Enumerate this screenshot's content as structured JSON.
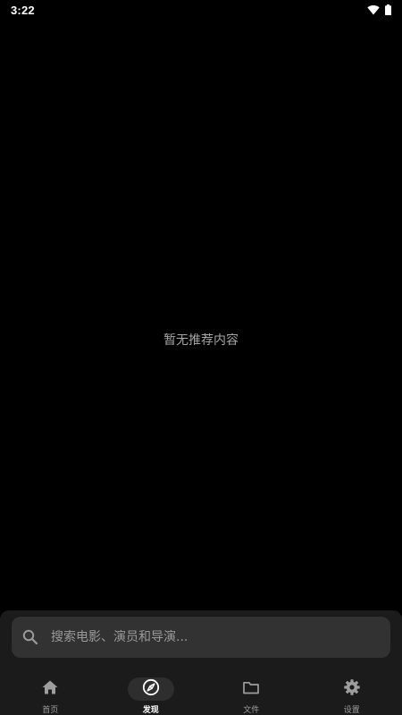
{
  "status_bar": {
    "time": "3:22",
    "icons": [
      "wifi-icon",
      "battery-icon"
    ]
  },
  "main": {
    "empty_message": "暂无推荐内容"
  },
  "search": {
    "placeholder": "搜索电影、演员和导演...",
    "value": ""
  },
  "nav": {
    "items": [
      {
        "label": "首页",
        "icon": "home-icon",
        "active": false
      },
      {
        "label": "发现",
        "icon": "compass-icon",
        "active": true
      },
      {
        "label": "文件",
        "icon": "folder-icon",
        "active": false
      },
      {
        "label": "设置",
        "icon": "gear-icon",
        "active": false
      }
    ]
  },
  "colors": {
    "background": "#000000",
    "panel": "#1b1b1b",
    "search_field": "#323232",
    "active_pill": "#2e2e2e",
    "muted_text": "#9e9e9e"
  }
}
